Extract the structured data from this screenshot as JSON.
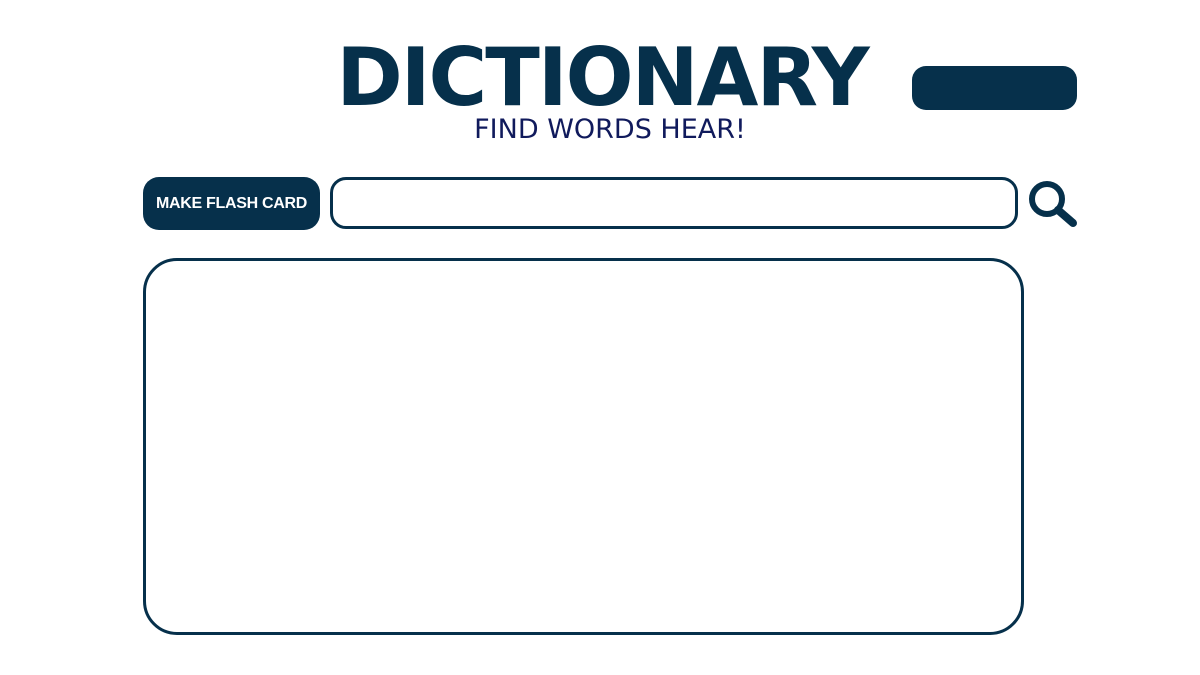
{
  "header": {
    "title": "DICTIONARY",
    "subtitle": "FIND WORDS HEAR!"
  },
  "toolbar": {
    "flash_card_label": "MAKE FLASH CARD",
    "search_value": "",
    "search_icon": "search-icon"
  },
  "colors": {
    "primary": "#06304b",
    "subtitle": "#101a5c",
    "background": "#ffffff"
  }
}
